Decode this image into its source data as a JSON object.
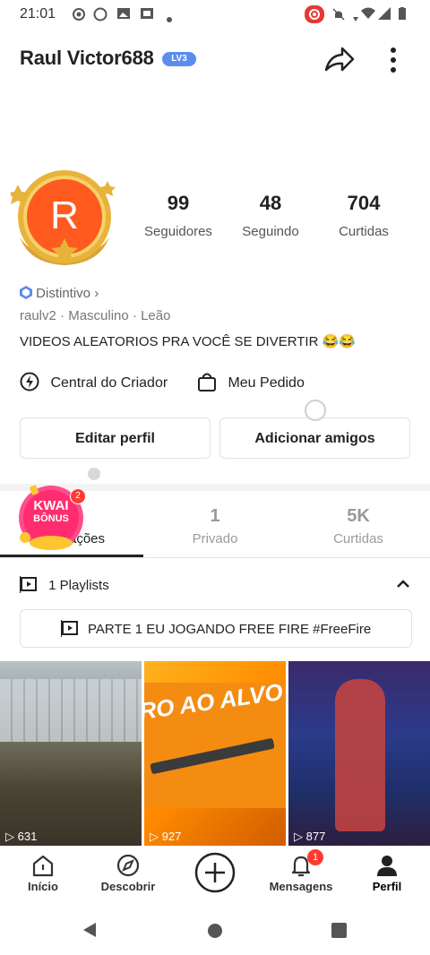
{
  "status_bar": {
    "time": "21:01"
  },
  "header": {
    "username": "Raul Victor688",
    "level_badge": "LV3"
  },
  "stats": [
    {
      "value": "99",
      "label": "Seguidores"
    },
    {
      "value": "48",
      "label": "Seguindo"
    },
    {
      "value": "704",
      "label": "Curtidas"
    }
  ],
  "avatar": {
    "letter": "R"
  },
  "badge_link": "Distintivo",
  "user_info": {
    "handle": "raulv2",
    "gender": "Masculino",
    "sign": "Leão"
  },
  "bio": "VIDEOS ALEATORIOS PRA VOCÊ SE DIVERTIR 😂😂",
  "links": {
    "creator_center": "Central do Criador",
    "my_orders": "Meu Pedido"
  },
  "buttons": {
    "edit_profile": "Editar perfil",
    "add_friends": "Adicionar amigos"
  },
  "promo": {
    "line1": "KWAI",
    "line2": "BÔNUS",
    "count": "2"
  },
  "tabs": [
    {
      "value": "",
      "label": "ações"
    },
    {
      "value": "1",
      "label": "Privado"
    },
    {
      "value": "5K",
      "label": "Curtidas"
    }
  ],
  "playlists": {
    "label": "1 Playlists",
    "item_title": "PARTE 1 EU JOGANDO FREE FIRE #FreeFire"
  },
  "videos": [
    {
      "views": "631"
    },
    {
      "views": "927"
    },
    {
      "views": "877"
    }
  ],
  "thumb_text": "RO AO ALVO",
  "bottom_nav": [
    {
      "label": "Início"
    },
    {
      "label": "Descobrir"
    },
    {
      "label": ""
    },
    {
      "label": "Mensagens",
      "badge": "1"
    },
    {
      "label": "Perfil"
    }
  ],
  "colors": {
    "accent_orange": "#ff5a1f",
    "gold": "#e8b33a",
    "badge_blue": "#5b8def",
    "notification_red": "#ff3b30"
  }
}
